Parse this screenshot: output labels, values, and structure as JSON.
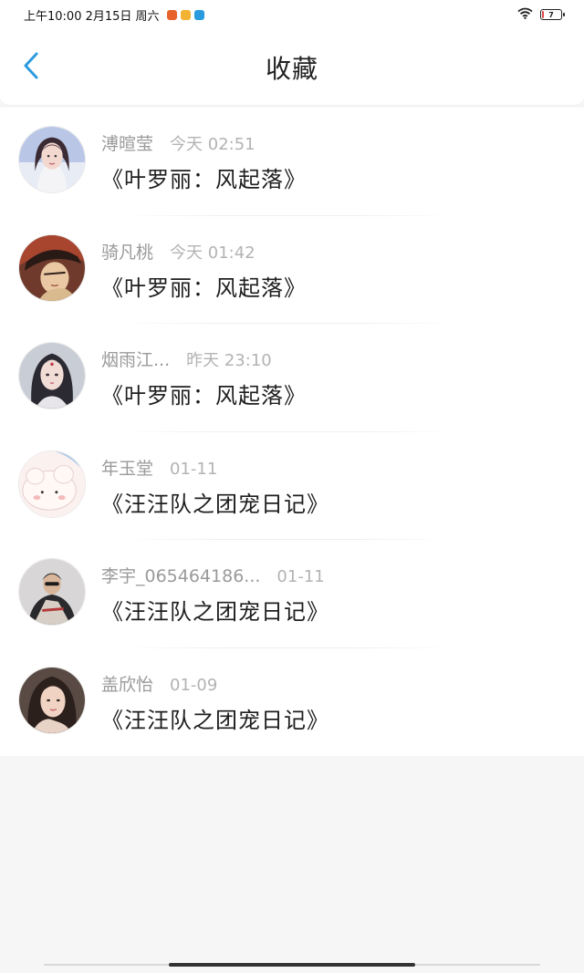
{
  "status_bar": {
    "time_date": "上午10:00 2月15日 周六",
    "battery_level": "7",
    "battery_fraction": 0.07,
    "app_icons": [
      "orange-app-icon",
      "yellow-app-icon",
      "blue-app-icon"
    ],
    "wifi_icon": "wifi-icon"
  },
  "header": {
    "back_icon": "chevron-left-icon",
    "title": "收藏",
    "accent_color": "#2d9bdf"
  },
  "favorites": [
    {
      "name": "溥暄莹",
      "time": "今天 02:51",
      "book": "《叶罗丽：风起落》"
    },
    {
      "name": "骑凡桃",
      "time": "今天 01:42",
      "book": "《叶罗丽：风起落》"
    },
    {
      "name": "烟雨江...",
      "time": "昨天 23:10",
      "book": "《叶罗丽：风起落》"
    },
    {
      "name": "年玉堂",
      "time": "01-11",
      "book": "《汪汪队之团宠日记》"
    },
    {
      "name": "李宇_065464186...",
      "time": "01-11",
      "book": "《汪汪队之团宠日记》"
    },
    {
      "name": "盖欣怡",
      "time": "01-09",
      "book": "《汪汪队之团宠日记》"
    }
  ]
}
